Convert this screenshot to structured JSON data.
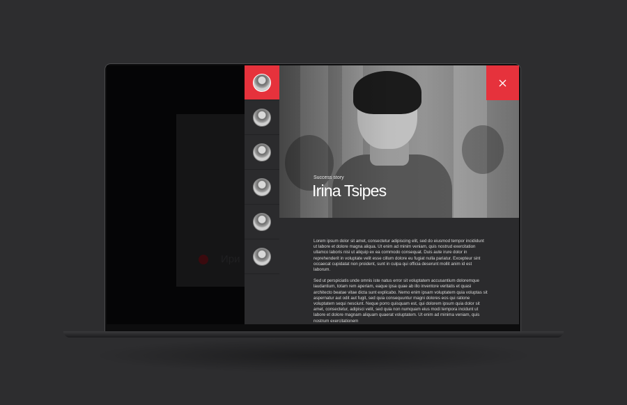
{
  "background_page": {
    "title_fragment": "Ири"
  },
  "thumbnails": [
    {
      "label": "Irina Tsipes",
      "active": true
    },
    {
      "label": "",
      "active": false
    },
    {
      "label": "",
      "active": false
    },
    {
      "label": "",
      "active": false
    },
    {
      "label": "",
      "active": false
    },
    {
      "label": "",
      "active": false
    }
  ],
  "story": {
    "kicker": "Success story",
    "name": "Irina Tsipes",
    "paragraphs": [
      "Lorem ipsum dolor sit amet, consectetur adipiscing elit, sed do eiusmod tempor incididunt ut labore et dolore magna aliqua. Ut enim ad minim veniam, quis nostrud exercitation ullamco laboris nisi ut aliquip ex ea commodo consequat. Duis aute irure dolor in reprehenderit in voluptate velit esse cillum dolore eu fugiat nulla pariatur. Excepteur sint occaecat cupidatat non proident, sunt in culpa qui officia deserunt mollit anim id est laborum.",
      "Sed ut perspiciatis unde omnis iste natus error sit voluptatem accusantium doloremque laudantium, totam rem aperiam, eaque ipsa quae ab illo inventore veritatis et quasi architecto beatae vitae dicta sunt explicabo. Nemo enim ipsam voluptatem quia voluptas sit aspernatur aut odit aut fugit, sed quia consequuntur magni dolores eos qui ratione voluptatem sequi nesciunt. Neque porro quisquam est, qui dolorem ipsum quia dolor sit amet, consectetur, adipisci velit, sed quia non numquam eius modi tempora incidunt ut labore et dolore magnam aliquam quaerat voluptatem. Ut enim ad minima veniam, quis nostrum exercitationem"
    ]
  },
  "colors": {
    "accent": "#e6323c",
    "panel": "#2b2b2d",
    "backdrop": "#2d2d2f"
  },
  "icons": {
    "close": "close-icon"
  }
}
